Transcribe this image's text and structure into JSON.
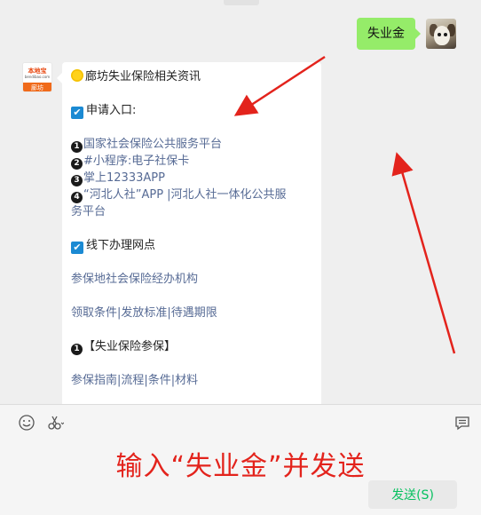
{
  "chat": {
    "outgoing": {
      "text": "失业金"
    },
    "incoming": {
      "avatar": {
        "brand": "本地宝",
        "site": "bendibao.com",
        "city": "廊坊"
      },
      "title": "廊坊失业保险相关资讯",
      "apply_heading": "申请入口:",
      "apply_items": [
        {
          "num": "1",
          "text": "国家社会保险公共服务平台"
        },
        {
          "num": "2",
          "text": "#小程序:电子社保卡"
        },
        {
          "num": "3",
          "text": "掌上12333APP"
        },
        {
          "num": "4",
          "text": "“河北人社”APP |河北人社一体化公共服",
          "cont": "务平台"
        }
      ],
      "offline_heading": "线下办理网点",
      "offline_link": "参保地社会保险经办机构",
      "conditions_links": "领取条件|发放标准|待遇期限",
      "section1_heading": "【失业保险参保】",
      "section1_links": "参保指南|流程|条件|材料"
    }
  },
  "toolbar": {
    "emoji_icon": "emoji-icon",
    "scissors_icon": "scissors-icon",
    "chat_icon": "chat-history-icon"
  },
  "instruction": "输入“失业金”并发送",
  "send_button": {
    "label": "发送(S)"
  },
  "colors": {
    "outgoing_bubble": "#95ec69",
    "link": "#576b95",
    "instruction": "#e3231c",
    "arrow": "#e3231c",
    "send_text": "#07c160"
  }
}
